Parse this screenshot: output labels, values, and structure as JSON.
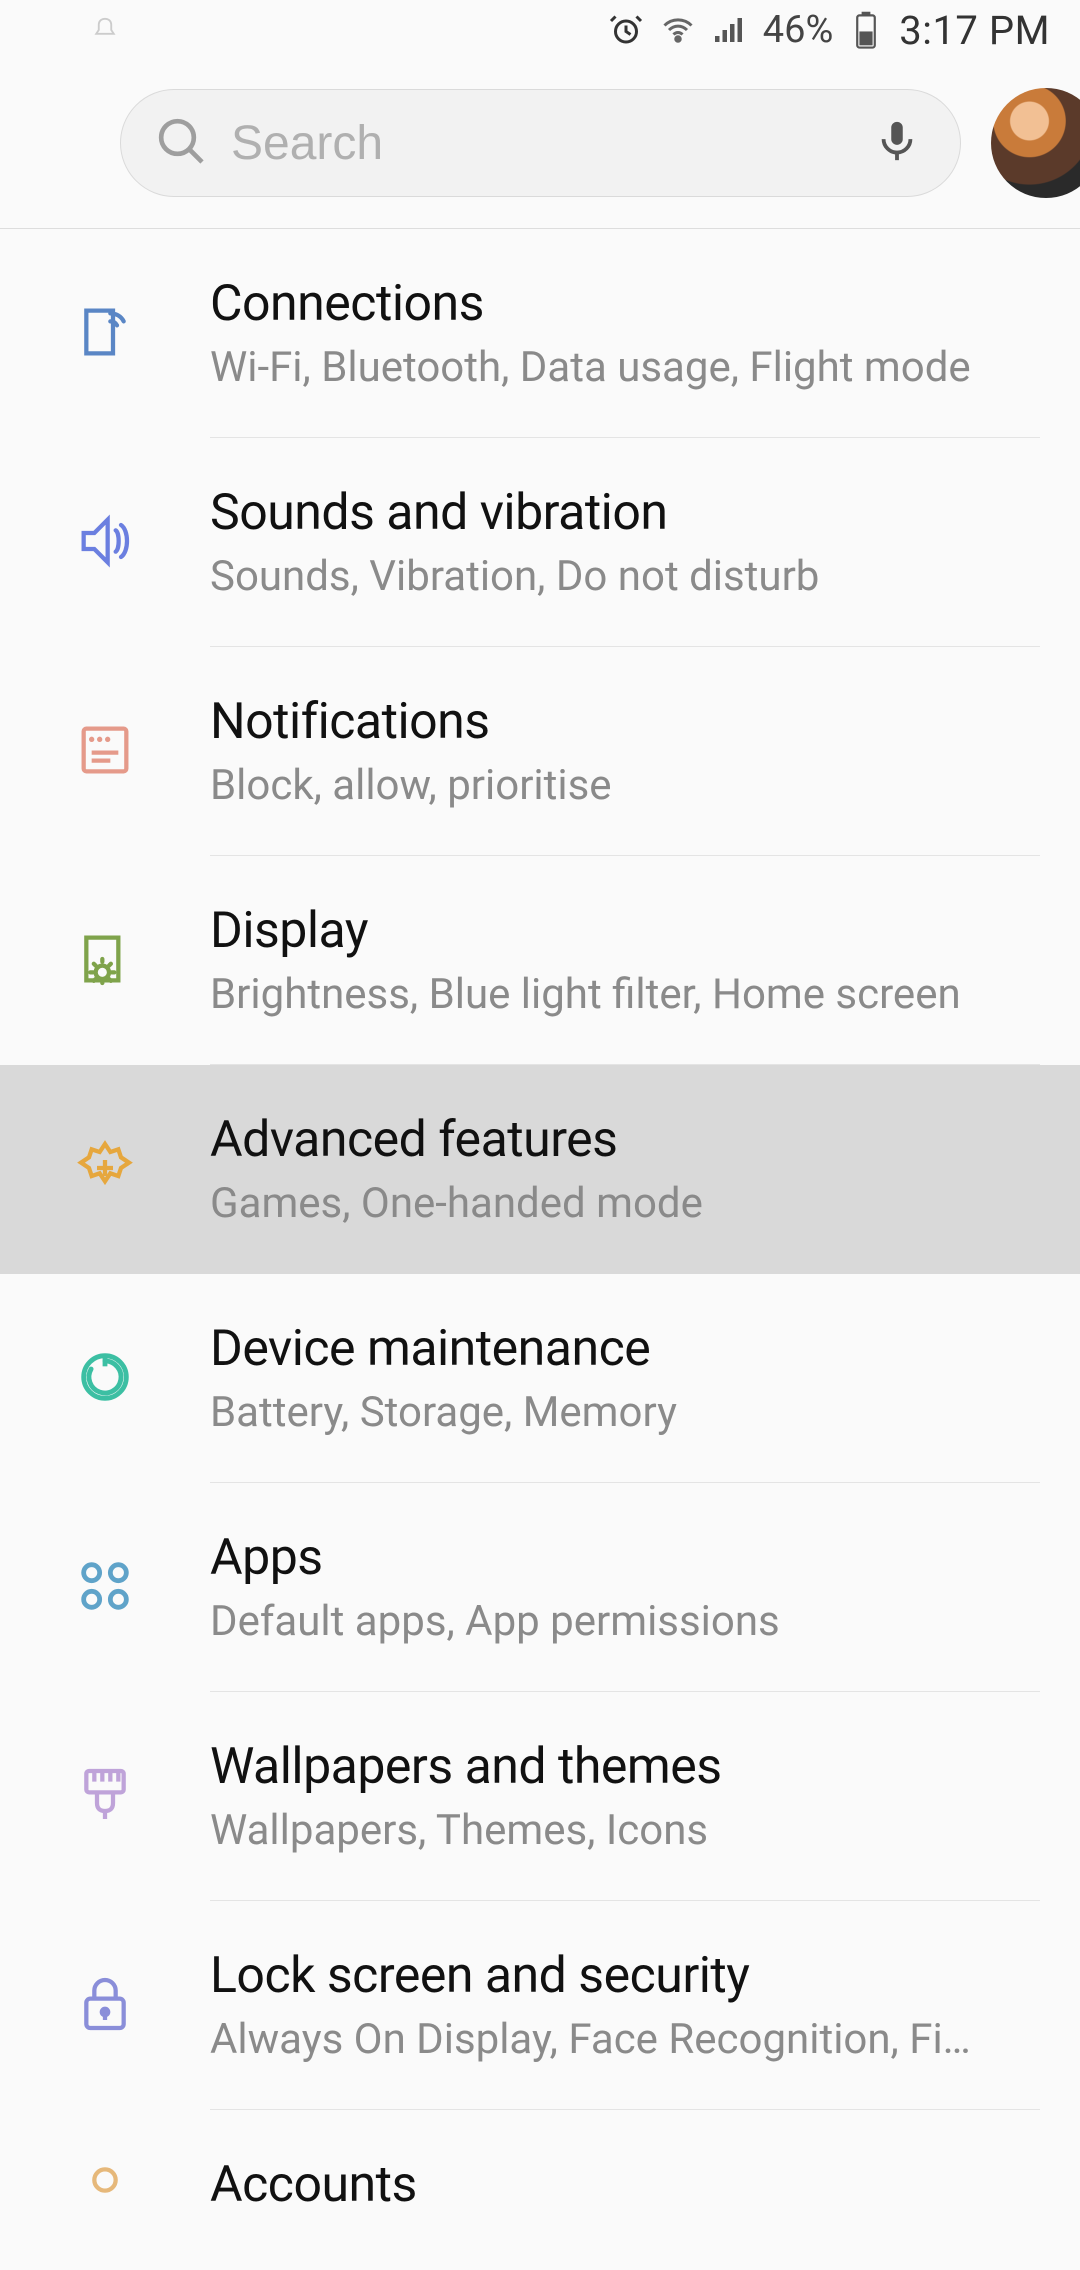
{
  "status_bar": {
    "battery_percent": "46%",
    "time": "3:17 PM"
  },
  "search": {
    "placeholder": "Search"
  },
  "settings": [
    {
      "id": "connections",
      "title": "Connections",
      "subtitle": "Wi-Fi, Bluetooth, Data usage, Flight mode",
      "color": "#5a86c5"
    },
    {
      "id": "sounds",
      "title": "Sounds and vibration",
      "subtitle": "Sounds, Vibration, Do not disturb",
      "color": "#6b7fe0"
    },
    {
      "id": "notifications",
      "title": "Notifications",
      "subtitle": "Block, allow, prioritise",
      "color": "#e59a8a"
    },
    {
      "id": "display",
      "title": "Display",
      "subtitle": "Brightness, Blue light filter, Home screen",
      "color": "#7fa34b"
    },
    {
      "id": "advanced",
      "title": "Advanced features",
      "subtitle": "Games, One-handed mode",
      "color": "#e6a73e",
      "selected": true
    },
    {
      "id": "device-maintenance",
      "title": "Device maintenance",
      "subtitle": "Battery, Storage, Memory",
      "color": "#3cbfa3"
    },
    {
      "id": "apps",
      "title": "Apps",
      "subtitle": "Default apps, App permissions",
      "color": "#5fa3c9"
    },
    {
      "id": "wallpapers",
      "title": "Wallpapers and themes",
      "subtitle": "Wallpapers, Themes, Icons",
      "color": "#bfa3d9"
    },
    {
      "id": "lock-screen",
      "title": "Lock screen and security",
      "subtitle": "Always On Display, Face Recognition, Fi…",
      "color": "#8a8ed9"
    },
    {
      "id": "accounts",
      "title": "Accounts",
      "subtitle": "",
      "color": "#e6b87a"
    }
  ]
}
